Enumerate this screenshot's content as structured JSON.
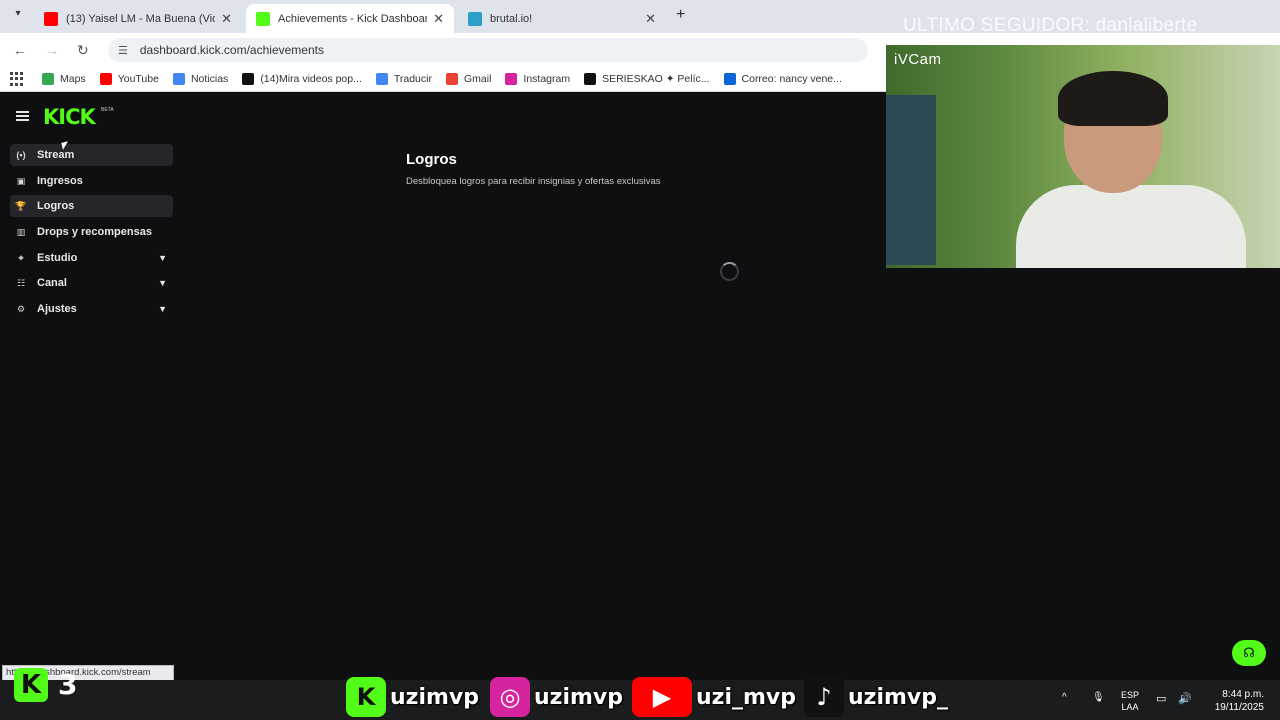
{
  "browser": {
    "tabs": [
      {
        "title": "(13) Yaisel LM - Ma Buena (Vid",
        "icon": "youtube-icon",
        "color": "#ff0000",
        "active": false
      },
      {
        "title": "Achievements - Kick Dashboard",
        "icon": "kick-icon",
        "color": "#53fc18",
        "active": true
      },
      {
        "title": "brutal.io!",
        "icon": "brutal-icon",
        "color": "#2aa0c8",
        "active": false
      }
    ],
    "url": "dashboard.kick.com/achievements",
    "bookmarks": [
      {
        "label": "Maps",
        "icon": "maps-icon",
        "color": "#34a853"
      },
      {
        "label": "YouTube",
        "icon": "youtube-icon",
        "color": "#ff0000"
      },
      {
        "label": "Noticias",
        "icon": "news-icon",
        "color": "#4285f4"
      },
      {
        "label": "(14)Mira videos pop...",
        "icon": "tiktok-icon",
        "color": "#111111"
      },
      {
        "label": "Traducir",
        "icon": "translate-icon",
        "color": "#4285f4"
      },
      {
        "label": "Gmail",
        "icon": "gmail-icon",
        "color": "#ea4335"
      },
      {
        "label": "Instagram",
        "icon": "instagram-icon",
        "color": "#d6249f"
      },
      {
        "label": "SERIESKAO ✦ Pelíc...",
        "icon": "k-icon",
        "color": "#111111"
      },
      {
        "label": "Correo: nancy vene...",
        "icon": "outlook-icon",
        "color": "#0a64d8"
      }
    ]
  },
  "stream_overlay": {
    "seguidor": "ULTIMO SEGUIDOR: danlaliberte",
    "webcam_label": "iVCam"
  },
  "kick": {
    "logo": "KICK",
    "beta": "BETA",
    "nav": [
      {
        "label": "Stream",
        "icon": "stream-icon",
        "glyph": "(•)",
        "selected": true,
        "expandable": false
      },
      {
        "label": "Ingresos",
        "icon": "income-icon",
        "glyph": "▣",
        "selected": false,
        "expandable": false
      },
      {
        "label": "Logros",
        "icon": "trophy-icon",
        "glyph": "🏆",
        "selected": true,
        "expandable": false
      },
      {
        "label": "Drops y recompensas",
        "icon": "drops-icon",
        "glyph": "▥",
        "selected": false,
        "expandable": false
      },
      {
        "label": "Estudio",
        "icon": "studio-icon",
        "glyph": "⌖",
        "selected": false,
        "expandable": true
      },
      {
        "label": "Canal",
        "icon": "channel-icon",
        "glyph": "☷",
        "selected": false,
        "expandable": true
      },
      {
        "label": "Ajustes",
        "icon": "settings-icon",
        "glyph": "⚙",
        "selected": false,
        "expandable": true
      }
    ],
    "title": "Logros",
    "subtitle": "Desbloquea logros para recibir insignias y ofertas exclusivas",
    "accent": "#53fc18"
  },
  "status_url": "https://dashboard.kick.com/stream",
  "overlay_bottom": {
    "kick_count": "3",
    "socials": [
      {
        "platform": "kick",
        "handle": "uzimvp",
        "color": "#53fc18",
        "glyph": "K"
      },
      {
        "platform": "instagram",
        "handle": "uzimvp",
        "color": "#d6249f",
        "glyph": "◎"
      },
      {
        "platform": "youtube",
        "handle": "uzi_mvp",
        "color": "#ff0000",
        "glyph": "▶"
      },
      {
        "platform": "tiktok",
        "handle": "uzimvp_",
        "color": "#111111",
        "glyph": "♪"
      }
    ]
  },
  "system": {
    "lang1": "ESP",
    "lang2": "LAA",
    "time": "8:44 p.m.",
    "date": "19/11/2025"
  }
}
